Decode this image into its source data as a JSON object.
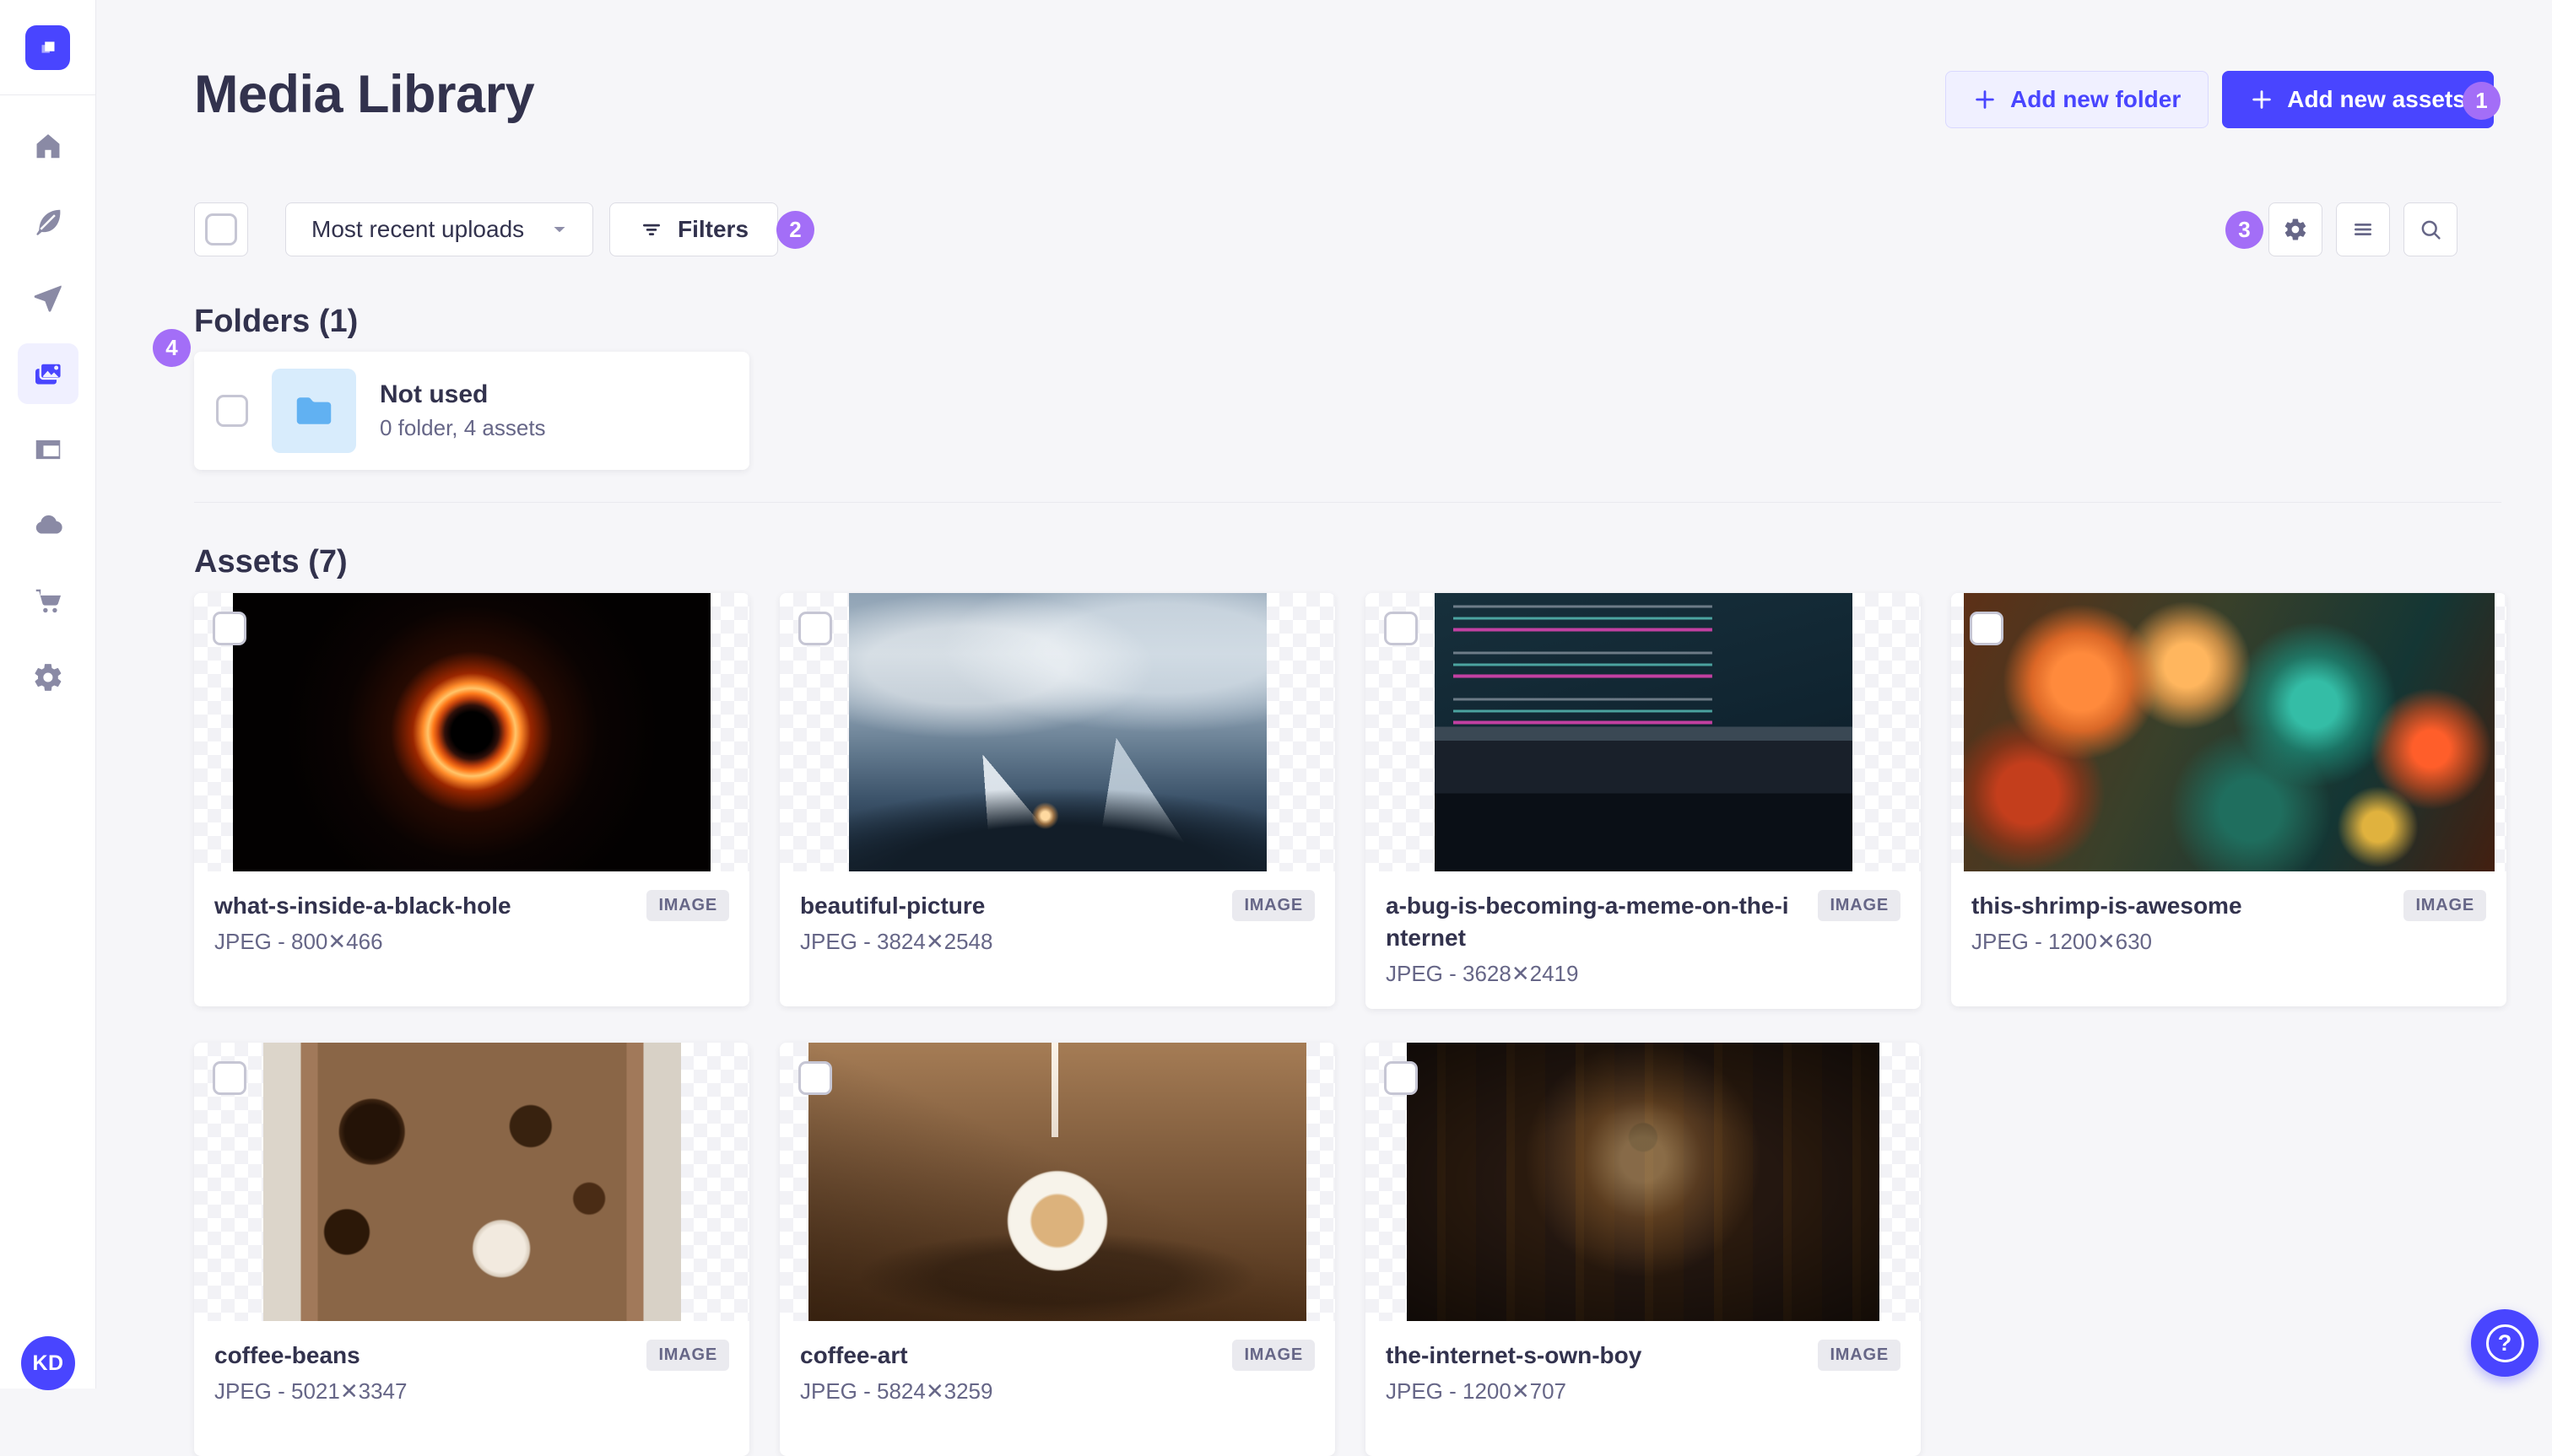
{
  "colors": {
    "primary": "#4945ff",
    "annotation_badge": "#a36ef7",
    "text": "#32324d",
    "text_secondary": "#666687",
    "border": "#dcdce4",
    "background": "#f6f6f9",
    "folder_icon": "#61b1f2"
  },
  "sidebar": {
    "items": [
      {
        "name": "home"
      },
      {
        "name": "content-manager"
      },
      {
        "name": "content-type-builder"
      },
      {
        "name": "media-library",
        "active": true
      },
      {
        "name": "plugins"
      },
      {
        "name": "deploy"
      },
      {
        "name": "marketplace"
      },
      {
        "name": "settings"
      }
    ],
    "user_initials": "KD"
  },
  "header": {
    "title": "Media Library",
    "add_new_folder": "Add new folder",
    "add_new_assets": "Add new assets"
  },
  "controls": {
    "sort_selected": "Most recent uploads",
    "filters_label": "Filters"
  },
  "annotations": {
    "badges": [
      "1",
      "2",
      "3",
      "4"
    ]
  },
  "folders": {
    "title": "Folders (1)",
    "items": [
      {
        "name": "Not used",
        "meta": "0 folder, 4 assets"
      }
    ]
  },
  "assets": {
    "title": "Assets (7)",
    "type_badge": "IMAGE",
    "items": [
      {
        "name": "what-s-inside-a-black-hole",
        "meta": "JPEG - 800✕466",
        "thumb": "width:566px;background-color:#030101;background-image:radial-gradient(circle at 50% 50%, #000 0 24px, #30100a 32px, #c2410c 40px, #ff7a1a 46px, #ffc56a 52px, #ff8c2a 58px, #992600 70px, #260a02 96px, #0a0302 150px, #030101 220px),radial-gradient(circle at 50% 50%, rgba(255,120,20,.15) 0 80px, transparent 150px)"
      },
      {
        "name": "beautiful-picture",
        "meta": "JPEG - 3824✕2548",
        "thumb": "width:495px;background-color:#33475a;background-image:radial-gradient(circle at 47% 80%, #ffd9a0 0 5px, rgba(255,170,80,.55) 10px, transparent 16px),radial-gradient(ellipse 70% 30% at 50% 100%, #121d28 0 55%, transparent 100%),conic-gradient(from 140deg at 32% 58%, rgba(235,241,246,.9) 0 36deg, transparent 36deg),conic-gradient(from 147deg at 64% 52%, rgba(200,213,224,.85) 0 42deg, transparent 42deg),radial-gradient(ellipse 60% 35% at 28% 26%, rgba(255,255,255,.5) 0 40%, transparent 75%),radial-gradient(ellipse 70% 40% at 75% 20%, rgba(231,238,244,.6) 0 40%, transparent 75%),linear-gradient(180deg, #8fa2b4 0%, #aebecb 22%, #8b9fb1 40%, #60778c 58%, #3c536a 74%, #24374a 88%, #15222e 100%)"
      },
      {
        "name": "a-bug-is-becoming-a-meme-on-the-internet",
        "meta": "JPEG - 3628✕2419",
        "thumb": "width:495px;background-color:#0a141c;background-repeat:no-repeat;background-image:repeating-linear-gradient(0deg, transparent 0 13px, rgba(238,70,188,.8) 13px 17px, transparent 17px 27px, rgba(105,228,216,.65) 27px 30px, transparent 30px 41px, rgba(196,203,214,.5) 41px 44px, transparent 44px 55px),linear-gradient(180deg, transparent 0 48%, #3a4854 48% 53%, #19202a 53% 72%, #0a0f16 72% 100%),linear-gradient(165deg, #17303c 0%, #102430 55%, #0b1822 100%);background-size:62% 48%,100% 100%,100% 100%;background-position:12% 6%,0 0,0 0"
      },
      {
        "name": "this-shrimp-is-awesome",
        "meta": "JPEG - 1200✕630",
        "thumb": "width:629px;background-color:#23301f;background-image:radial-gradient(circle at 22% 32%, #ff8a3c 0 34px, rgba(255,115,40,.8) 58px, transparent 92px),radial-gradient(circle at 42% 26%, #ffb65e 0 26px, rgba(255,170,80,.7) 46px, transparent 76px),radial-gradient(circle at 66% 40%, #34bda6 0 28px, rgba(28,148,128,.65) 58px, transparent 98px),radial-gradient(circle at 88% 56%, #ff5e2a 0 22px, rgba(230,80,30,.6) 48px, transparent 72px),radial-gradient(circle at 12% 72%, #c43e1c 0 36px, rgba(160,50,20,.6) 64px, transparent 92px),radial-gradient(circle at 54% 78%, #1f6e5e 0 36px, transparent 96px),radial-gradient(circle at 78% 84%, #e0b23e 0 18px, transparent 48px),linear-gradient(115deg, #5d3017 0%, #39402a 40%, #143634 72%, #431f10 100%)"
      },
      {
        "name": "coffee-beans",
        "meta": "JPEG - 5021✕3347",
        "thumb": "width:495px;background-color:#e6e0d6;background-image:radial-gradient(circle at 26% 32%, #241307 0 32px, #3e2512 38px, transparent 40px),radial-gradient(circle at 20% 68%, #2c1808 0 26px, transparent 28px),radial-gradient(circle at 57% 74%, #f2eadf 0 28px, #d9cdbd 33px, transparent 35px),radial-gradient(circle at 64% 30%, #38220f 0 24px, transparent 26px),radial-gradient(circle at 78% 56%, #4a2c15 0 18px, transparent 20px),linear-gradient(90deg, #dcd5ca 0 9%, #a1795a 9% 13%, #8a6647 13% 87%, #a1795a 87% 91%, #d8d1c6 91% 100%)"
      },
      {
        "name": "coffee-art",
        "meta": "JPEG - 5824✕3259",
        "thumb": "width:590px;background-color:#6e4e33;background-repeat:no-repeat;background-image:linear-gradient(180deg, rgba(255,249,240,.95), rgba(255,249,240,.8)),radial-gradient(circle at 50% 64%, #dcb27c 0 30px, #f7f3ea 33px 56px, #efe8dc 58px, transparent 60px),radial-gradient(ellipse 40% 16% at 50% 84%, rgba(25,14,6,.4) 0 60%, transparent 100%),linear-gradient(25deg, rgba(36,20,8,.55), transparent 55%),linear-gradient(180deg, #a57c55 0%, #7d5a3b 45%, #4e3119 100%);background-size:8px 34%,100% 100%,100% 100%,100% 100%,100% 100%;background-position:49.4% 0,0 0,0 0,0 0,0 0"
      },
      {
        "name": "the-internet-s-own-boy",
        "meta": "JPEG - 1200✕707",
        "thumb": "width:560px;background-color:#130e09;background-image:radial-gradient(ellipse 80% 70% at 50% 50%, transparent 35%, rgba(0,0,0,.6) 100%),radial-gradient(circle at 50% 42%, rgba(255,208,140,.45) 0 26px, rgba(205,140,70,.3) 70px, transparent 140px),radial-gradient(circle at 50% 34%, #0e0a06 0 16px, transparent 18px),repeating-linear-gradient(90deg, #241710 0 36px, #33200f 36px 46px, #2a1a0e 46px 82px),linear-gradient(180deg, #0f0b08, #1c130c)"
      }
    ]
  },
  "user": {
    "initials": "KD"
  },
  "fab": {
    "label": "?"
  }
}
